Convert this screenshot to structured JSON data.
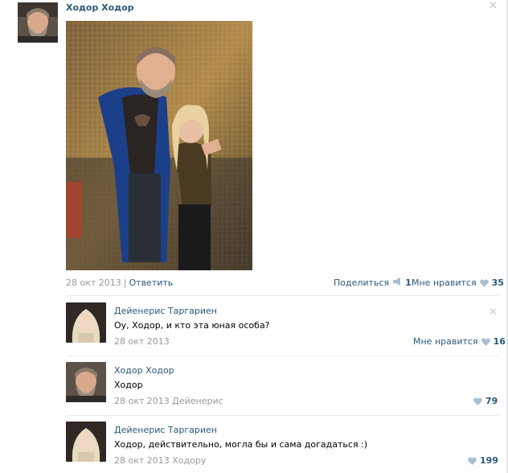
{
  "post": {
    "author": "Ходор Ходор",
    "date": "28 окт 2013",
    "reply_label": "Ответить",
    "share_label": "Поделиться",
    "share_count": "1",
    "like_label": "Мне нравится",
    "like_count": "35"
  },
  "comments": [
    {
      "author": "Дейенерис Таргариен",
      "text": "Оу, Ходор, и кто эта юная особа?",
      "meta": "28 окт 2013",
      "like_label": "Мне нравится",
      "like_count": "16"
    },
    {
      "author": "Ходор Ходор",
      "text": "Ходор",
      "meta": "28 окт 2013 Дейенерис",
      "like_count": "79"
    },
    {
      "author": "Дейенерис Таргариен",
      "text": "Ходор, действительно, могла бы и сама догадаться :)",
      "meta": "28 окт 2013 Ходору",
      "like_count": "199"
    }
  ],
  "icons": {
    "close": "close-icon",
    "share": "megaphone-icon",
    "like": "heart-icon"
  },
  "colors": {
    "link": "#2b587a",
    "muted": "#999999",
    "heart": "#a9bed1"
  }
}
